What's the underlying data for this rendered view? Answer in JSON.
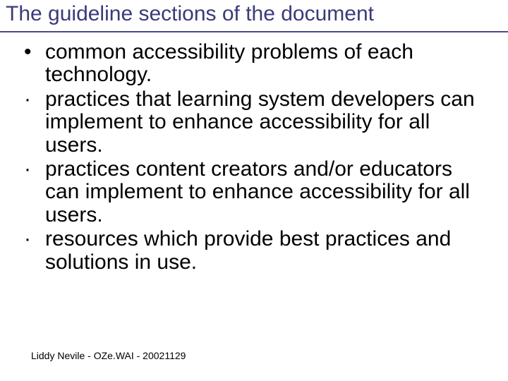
{
  "slide": {
    "title": "The guideline sections of the document",
    "bullets": [
      {
        "marker": "•",
        "text": "common accessibility problems of each technology."
      },
      {
        "marker": "·",
        "text": "practices that learning system developers can implement to enhance accessibility for all users."
      },
      {
        "marker": "·",
        "text": "practices content creators and/or educators can implement to enhance accessibility for all users."
      },
      {
        "marker": "·",
        "text": "resources which provide best practices and solutions in use."
      }
    ],
    "footer": "Liddy Nevile - OZe.WAI - 20021129"
  }
}
